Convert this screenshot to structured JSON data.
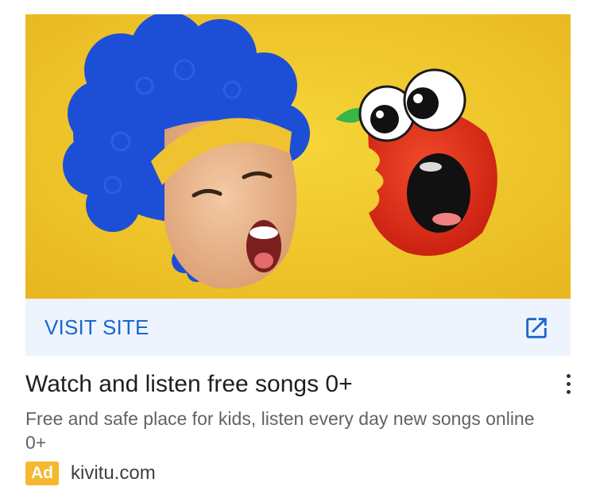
{
  "ad": {
    "visit_label": "VISIT SITE",
    "headline": "Watch and listen free songs 0+",
    "description": "Free and safe place for kids, listen every day new songs online 0+",
    "badge": "Ad",
    "domain": "kivitu.com"
  },
  "colors": {
    "hero_background": "#f2c62a",
    "visit_bar_background": "#eef4fd",
    "visit_text": "#1a66d0",
    "badge_background": "#f5b82e"
  },
  "icons": {
    "external": "external-link-icon",
    "menu": "more-vert-icon"
  }
}
